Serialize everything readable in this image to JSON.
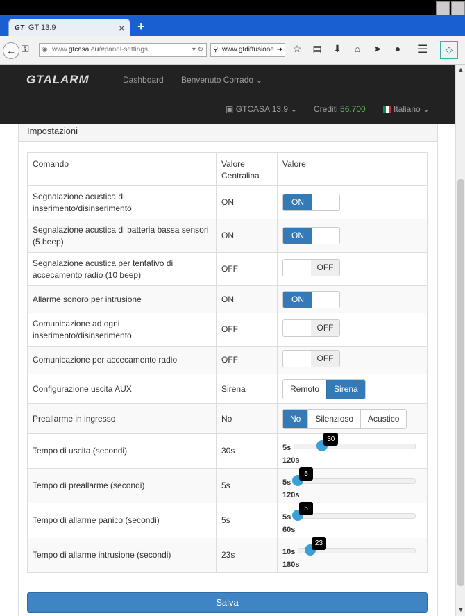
{
  "browser": {
    "tab_icon_text": "GT",
    "tab_title": "GT 13.9",
    "tab_close": "×",
    "new_tab": "+",
    "url_prefix": "www.",
    "url_domain": "gtcasa.eu",
    "url_path": "/#panel-settings",
    "search_value": "www.gtdiffusione"
  },
  "app": {
    "logo": "GTALARM",
    "nav_dashboard": "Dashboard",
    "nav_welcome": "Benvenuto Corrado",
    "nav_device": "GTCASA 13.9",
    "credits_label": "Crediti",
    "credits_value": "56.700",
    "language": "Italiano"
  },
  "panel": {
    "title": "Impostazioni",
    "headers": [
      "Comando",
      "Valore Centralina",
      "Valore"
    ],
    "rows": [
      {
        "command": "Segnalazione acustica di inserimento/disinserimento",
        "central": "ON",
        "toggle": "ON"
      },
      {
        "command": "Segnalazione acustica di batteria bassa sensori (5 beep)",
        "central": "ON",
        "toggle": "ON"
      },
      {
        "command": "Segnalazione acustica per tentativo di accecamento radio (10 beep)",
        "central": "OFF",
        "toggle": "OFF"
      },
      {
        "command": "Allarme sonoro per intrusione",
        "central": "ON",
        "toggle": "ON"
      },
      {
        "command": "Comunicazione ad ogni inserimento/disinserimento",
        "central": "OFF",
        "toggle": "OFF"
      },
      {
        "command": "Comunicazione per accecamento radio",
        "central": "OFF",
        "toggle": "OFF"
      },
      {
        "command": "Configurazione uscita AUX",
        "central": "Sirena",
        "options": [
          "Remoto",
          "Sirena"
        ],
        "selected": "Sirena"
      },
      {
        "command": "Preallarme in ingresso",
        "central": "No",
        "options": [
          "No",
          "Silenzioso",
          "Acustico"
        ],
        "selected": "No"
      },
      {
        "command": "Tempo di uscita (secondi)",
        "central": "30s",
        "slider": {
          "min": 5,
          "max": 120,
          "value": 30,
          "min_label": "5s",
          "max_label": "120s",
          "tip": "30"
        }
      },
      {
        "command": "Tempo di preallarme (secondi)",
        "central": "5s",
        "slider": {
          "min": 5,
          "max": 120,
          "value": 5,
          "min_label": "5s",
          "max_label": "120s",
          "tip": "5"
        }
      },
      {
        "command": "Tempo di allarme panico (secondi)",
        "central": "5s",
        "slider": {
          "min": 5,
          "max": 60,
          "value": 5,
          "min_label": "5s",
          "max_label": "60s",
          "tip": "5"
        }
      },
      {
        "command": "Tempo di allarme intrusione (secondi)",
        "central": "23s",
        "slider": {
          "min": 10,
          "max": 180,
          "value": 23,
          "min_label": "10s",
          "max_label": "180s",
          "tip": "23"
        }
      }
    ],
    "save_label": "Salva"
  }
}
